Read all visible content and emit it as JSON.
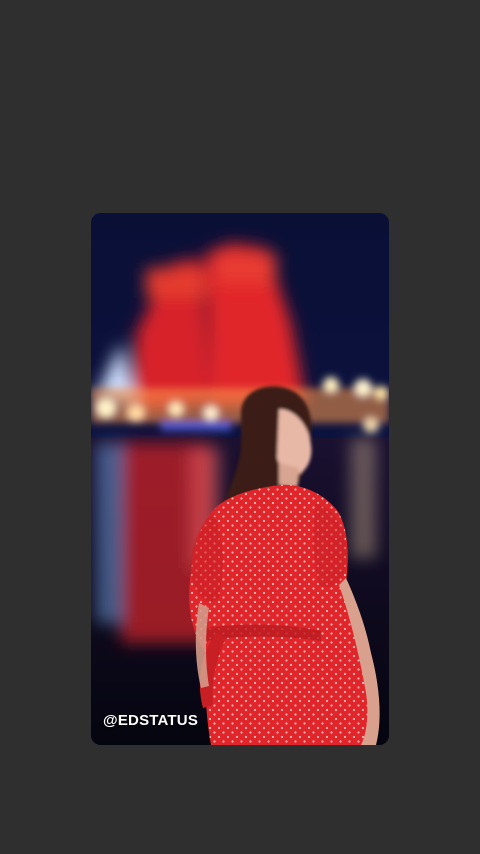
{
  "media": {
    "description_icon": "photo",
    "watermark": "@EDSTATUS"
  }
}
